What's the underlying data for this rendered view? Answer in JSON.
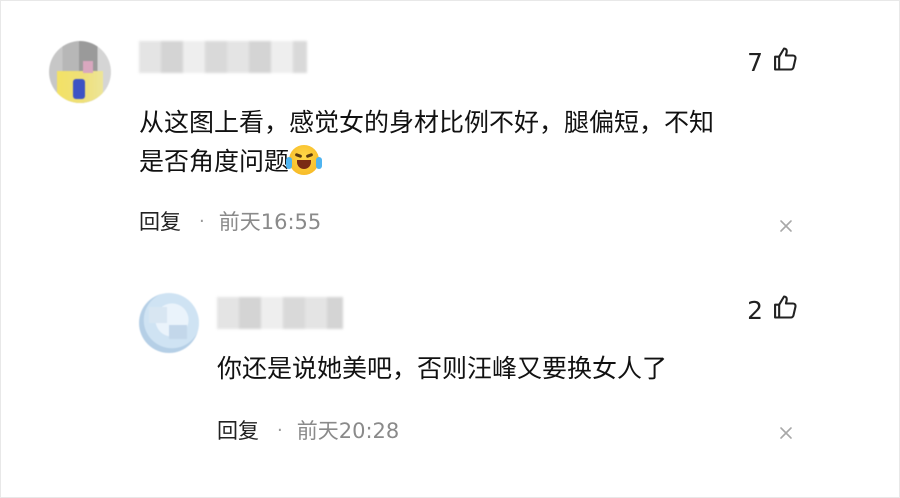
{
  "comments": [
    {
      "likes": "7",
      "text_line1": "从这图上看，感觉女的身材比例不好，腿偏短，不知",
      "text_line2": "是否角度问题",
      "emoji": "laughing-crying-emoji",
      "reply_label": "回复",
      "separator": "·",
      "time": "前天16:55"
    },
    {
      "likes": "2",
      "text_line1": "你还是说她美吧，否则汪峰又要换女人了",
      "reply_label": "回复",
      "separator": "·",
      "time": "前天20:28"
    }
  ],
  "icons": {
    "like": "thumbs-up-icon",
    "close": "close-icon"
  }
}
